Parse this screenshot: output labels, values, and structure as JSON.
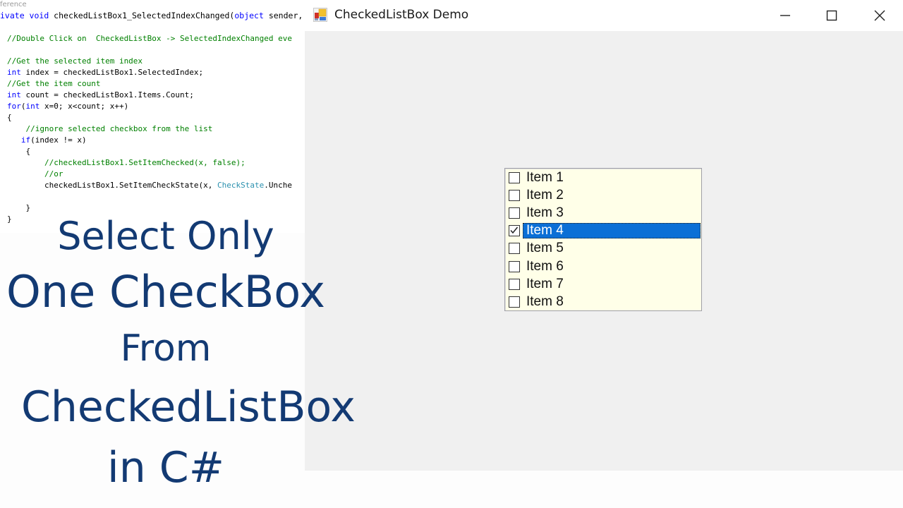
{
  "code_editor": {
    "reference_hint": "ference",
    "signature": [
      {
        "t": "ivate ",
        "c": "kw"
      },
      {
        "t": "void",
        "c": "kw"
      },
      {
        "t": " checkedListBox1_SelectedIndexChanged(",
        "c": ""
      },
      {
        "t": "object",
        "c": "kw"
      },
      {
        "t": " sender,",
        "c": ""
      }
    ],
    "lines": [
      [
        {
          "t": "//Double Click on  CheckedListBox -> SelectedIndexChanged eve",
          "c": "cm"
        }
      ],
      [],
      [
        {
          "t": "//Get the selected item index",
          "c": "cm"
        }
      ],
      [
        {
          "t": "int",
          "c": "kw"
        },
        {
          "t": " index = checkedListBox1.SelectedIndex;",
          "c": ""
        }
      ],
      [
        {
          "t": "//Get the item count",
          "c": "cm"
        }
      ],
      [
        {
          "t": "int",
          "c": "kw"
        },
        {
          "t": " count = checkedListBox1.Items.Count;",
          "c": ""
        }
      ],
      [
        {
          "t": "for",
          "c": "kw"
        },
        {
          "t": "(",
          "c": ""
        },
        {
          "t": "int",
          "c": "kw"
        },
        {
          "t": " x=0; x<count; x++)",
          "c": ""
        }
      ],
      [
        {
          "t": "{",
          "c": ""
        }
      ],
      [
        {
          "t": "    ",
          "c": ""
        },
        {
          "t": "//ignore selected checkbox from the list",
          "c": "cm"
        }
      ],
      [
        {
          "t": "   ",
          "c": ""
        },
        {
          "t": "if",
          "c": "kw"
        },
        {
          "t": "(index != x)",
          "c": ""
        }
      ],
      [
        {
          "t": "    {",
          "c": ""
        }
      ],
      [
        {
          "t": "        ",
          "c": ""
        },
        {
          "t": "//checkedListBox1.SetItemChecked(x, false);",
          "c": "cm"
        }
      ],
      [
        {
          "t": "        ",
          "c": ""
        },
        {
          "t": "//or",
          "c": "cm"
        }
      ],
      [
        {
          "t": "        checkedListBox1.SetItemCheckState(x, ",
          "c": ""
        },
        {
          "t": "CheckState",
          "c": "ty"
        },
        {
          "t": ".Unche",
          "c": ""
        }
      ],
      [],
      [
        {
          "t": "    }",
          "c": ""
        }
      ],
      [
        {
          "t": "}",
          "c": ""
        }
      ]
    ]
  },
  "overlay_title": {
    "line1": "Select Only",
    "line2": "One CheckBox",
    "line3": "From",
    "line4": "CheckedListBox",
    "line5": "in C#",
    "color": "#133a73"
  },
  "window": {
    "title": "CheckedListBox Demo",
    "app_icon": "winforms-app-icon",
    "controls": {
      "minimize": "minimize-icon",
      "maximize": "maximize-icon",
      "close": "close-icon"
    }
  },
  "checked_list_box": {
    "background": "#ffffe8",
    "selection_color": "#0b6fd6",
    "selected_index": 3,
    "items": [
      {
        "label": "Item 1",
        "checked": false
      },
      {
        "label": "Item 2",
        "checked": false
      },
      {
        "label": "Item 3",
        "checked": false
      },
      {
        "label": "Item 4",
        "checked": true
      },
      {
        "label": "Item 5",
        "checked": false
      },
      {
        "label": "Item 6",
        "checked": false
      },
      {
        "label": "Item 7",
        "checked": false
      },
      {
        "label": "Item 8",
        "checked": false
      }
    ]
  }
}
